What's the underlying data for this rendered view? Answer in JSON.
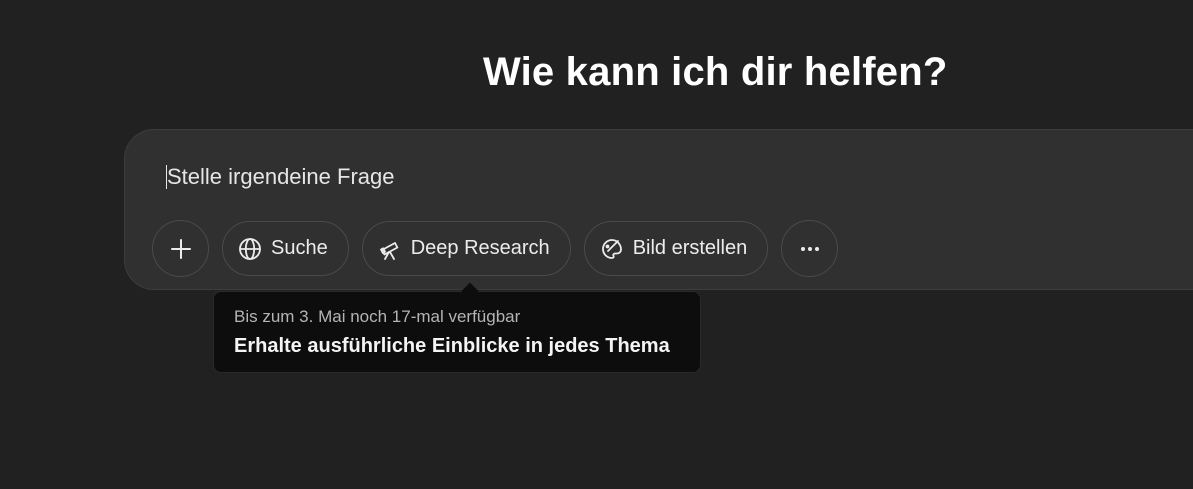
{
  "heading": "Wie kann ich dir helfen?",
  "composer": {
    "placeholder": "Stelle irgendeine Frage",
    "buttons": {
      "add_icon": "plus-icon",
      "search": {
        "label": "Suche",
        "icon": "globe-icon"
      },
      "deep_research": {
        "label": "Deep Research",
        "icon": "telescope-icon"
      },
      "create_image": {
        "label": "Bild erstellen",
        "icon": "palette-icon"
      },
      "more_icon": "ellipsis-icon"
    }
  },
  "tooltip": {
    "subtitle": "Bis zum 3. Mai noch 17-mal verfügbar",
    "title": "Erhalte ausführliche Einblicke in jedes Thema"
  },
  "colors": {
    "background": "#212121",
    "composer": "#303030",
    "tooltip": "#0d0d0d",
    "text": "#ececec"
  }
}
